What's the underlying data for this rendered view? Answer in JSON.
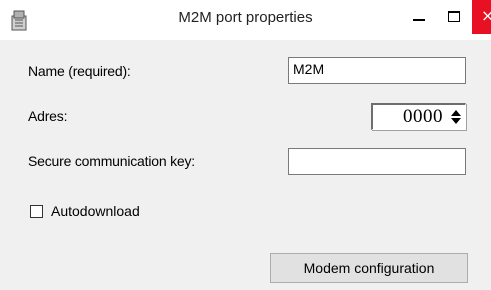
{
  "window": {
    "title": "M2M port properties",
    "minimize_glyph": "–",
    "maximize_glyph": "□",
    "close_glyph": "×"
  },
  "form": {
    "name_label": "Name (required):",
    "name_value": "M2M",
    "adres_label": "Adres:",
    "adres_value": "0000",
    "key_label": "Secure communication key:",
    "key_value": "",
    "autodownload_label": "Autodownload",
    "autodownload_checked": false,
    "modem_button_label": "Modem configuration"
  },
  "icons": [
    "app-icon",
    "minimize-icon",
    "maximize-icon",
    "close-icon",
    "spin-up-icon",
    "spin-down-icon"
  ],
  "colors": {
    "close_button": "#e81123",
    "dialog_background": "#f0f0f0",
    "button_background": "#e1e1e1"
  }
}
